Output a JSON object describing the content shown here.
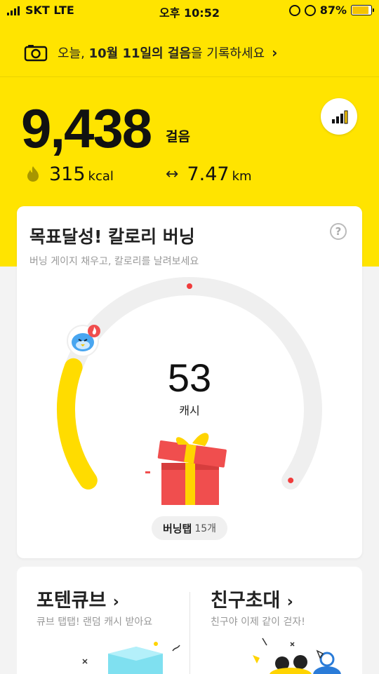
{
  "status_bar": {
    "carrier": "SKT LTE",
    "time": "오후 10:52",
    "battery": "87%",
    "battery_level": 0.87
  },
  "record_banner": {
    "prefix": "오늘, ",
    "date_bold": "10월 11일의 걸음",
    "suffix": "을 기록하세요"
  },
  "steps": {
    "count": "9,438",
    "unit": "걸음"
  },
  "stats": {
    "calories": "315",
    "calories_unit": "kcal",
    "distance": "7.47",
    "distance_unit": "km"
  },
  "burning_card": {
    "title": "목표달성! 칼로리 버닝",
    "subtitle": "버닝 게이지 채우고, 칼로리를 날려보세요",
    "help": "?",
    "cash_value": "53",
    "cash_unit": "캐시",
    "gauge_progress": 0.22,
    "pill_label": "버닝탭",
    "pill_count": "15개"
  },
  "bottom_cards": {
    "left": {
      "title": "포텐큐브",
      "subtitle": "큐브 탭탭! 랜덤 캐시 받아요"
    },
    "right": {
      "title": "친구초대",
      "subtitle": "친구야 이제 같이 걷자!"
    }
  },
  "colors": {
    "brand_yellow": "#ffe400",
    "gauge_fill": "#ffdc00",
    "gauge_track": "#efefef",
    "marker_red": "#f03c3c"
  }
}
